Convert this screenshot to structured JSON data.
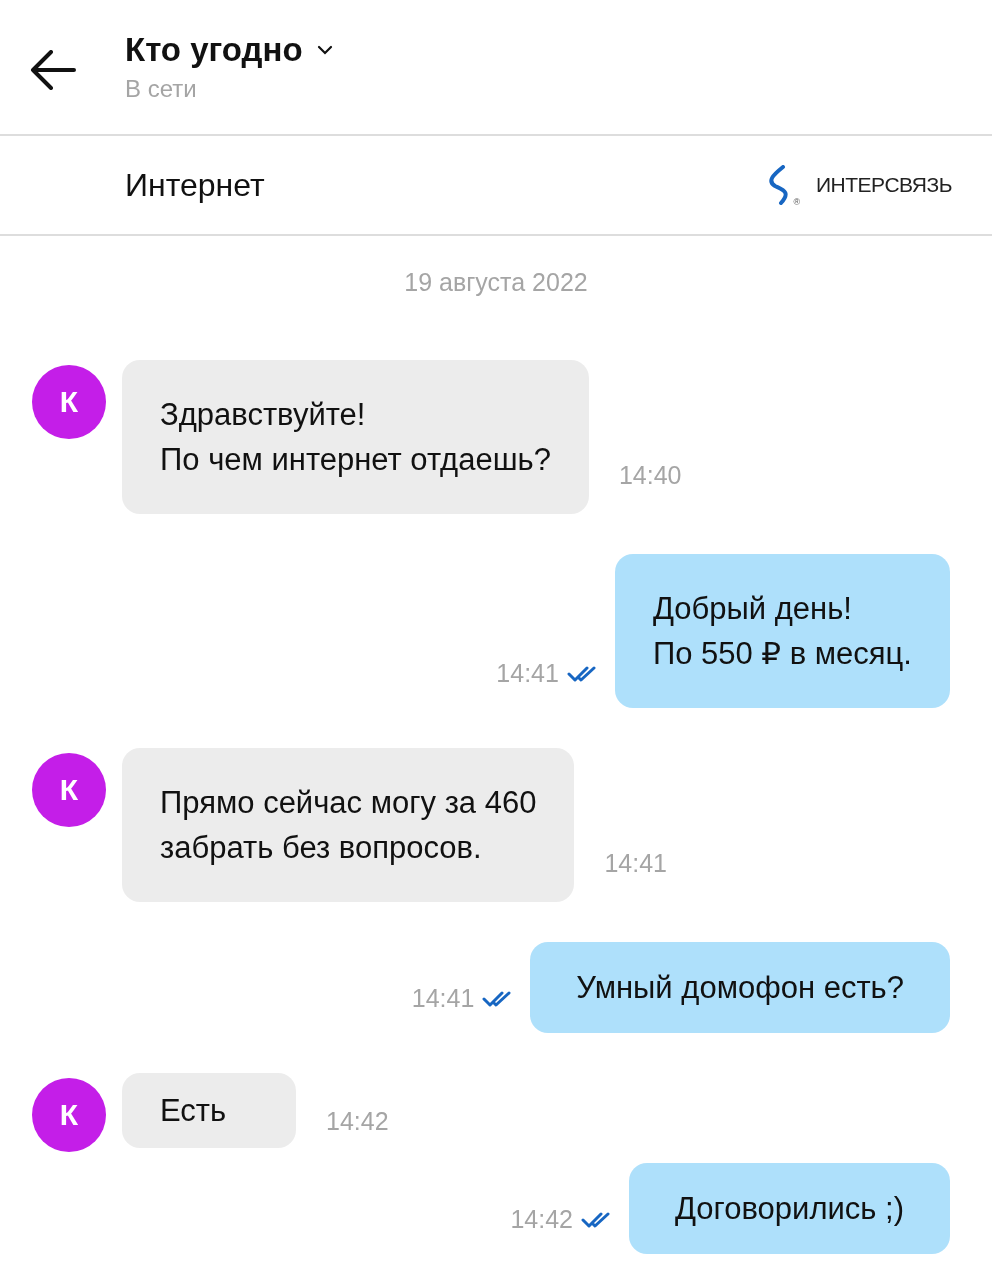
{
  "header": {
    "title": "Кто угодно",
    "status": "В сети"
  },
  "topic": {
    "title": "Интернет",
    "brand": "ИНТЕРСВЯЗЬ",
    "brand_mark": "®"
  },
  "date": "19 августа 2022",
  "messages": [
    {
      "kind": "incoming",
      "avatar": "К",
      "lines": [
        "Здравствуйте!",
        "По чем интернет отдаешь?"
      ],
      "time": "14:40"
    },
    {
      "kind": "outgoing",
      "lines": [
        "Добрый день!",
        "По 550 ₽ в месяц."
      ],
      "time": "14:41",
      "read": true
    },
    {
      "kind": "incoming",
      "avatar": "К",
      "lines": [
        "Прямо сейчас могу за 460",
        "забрать без вопросов."
      ],
      "time": "14:41"
    },
    {
      "kind": "outgoing",
      "lines": [
        "Умный домофон есть?"
      ],
      "time": "14:41",
      "read": true
    },
    {
      "kind": "incoming",
      "avatar": "К",
      "lines": [
        "Есть"
      ],
      "time": "14:42"
    },
    {
      "kind": "outgoing",
      "lines": [
        "Договорились ;)"
      ],
      "time": "14:42",
      "read": true
    }
  ]
}
